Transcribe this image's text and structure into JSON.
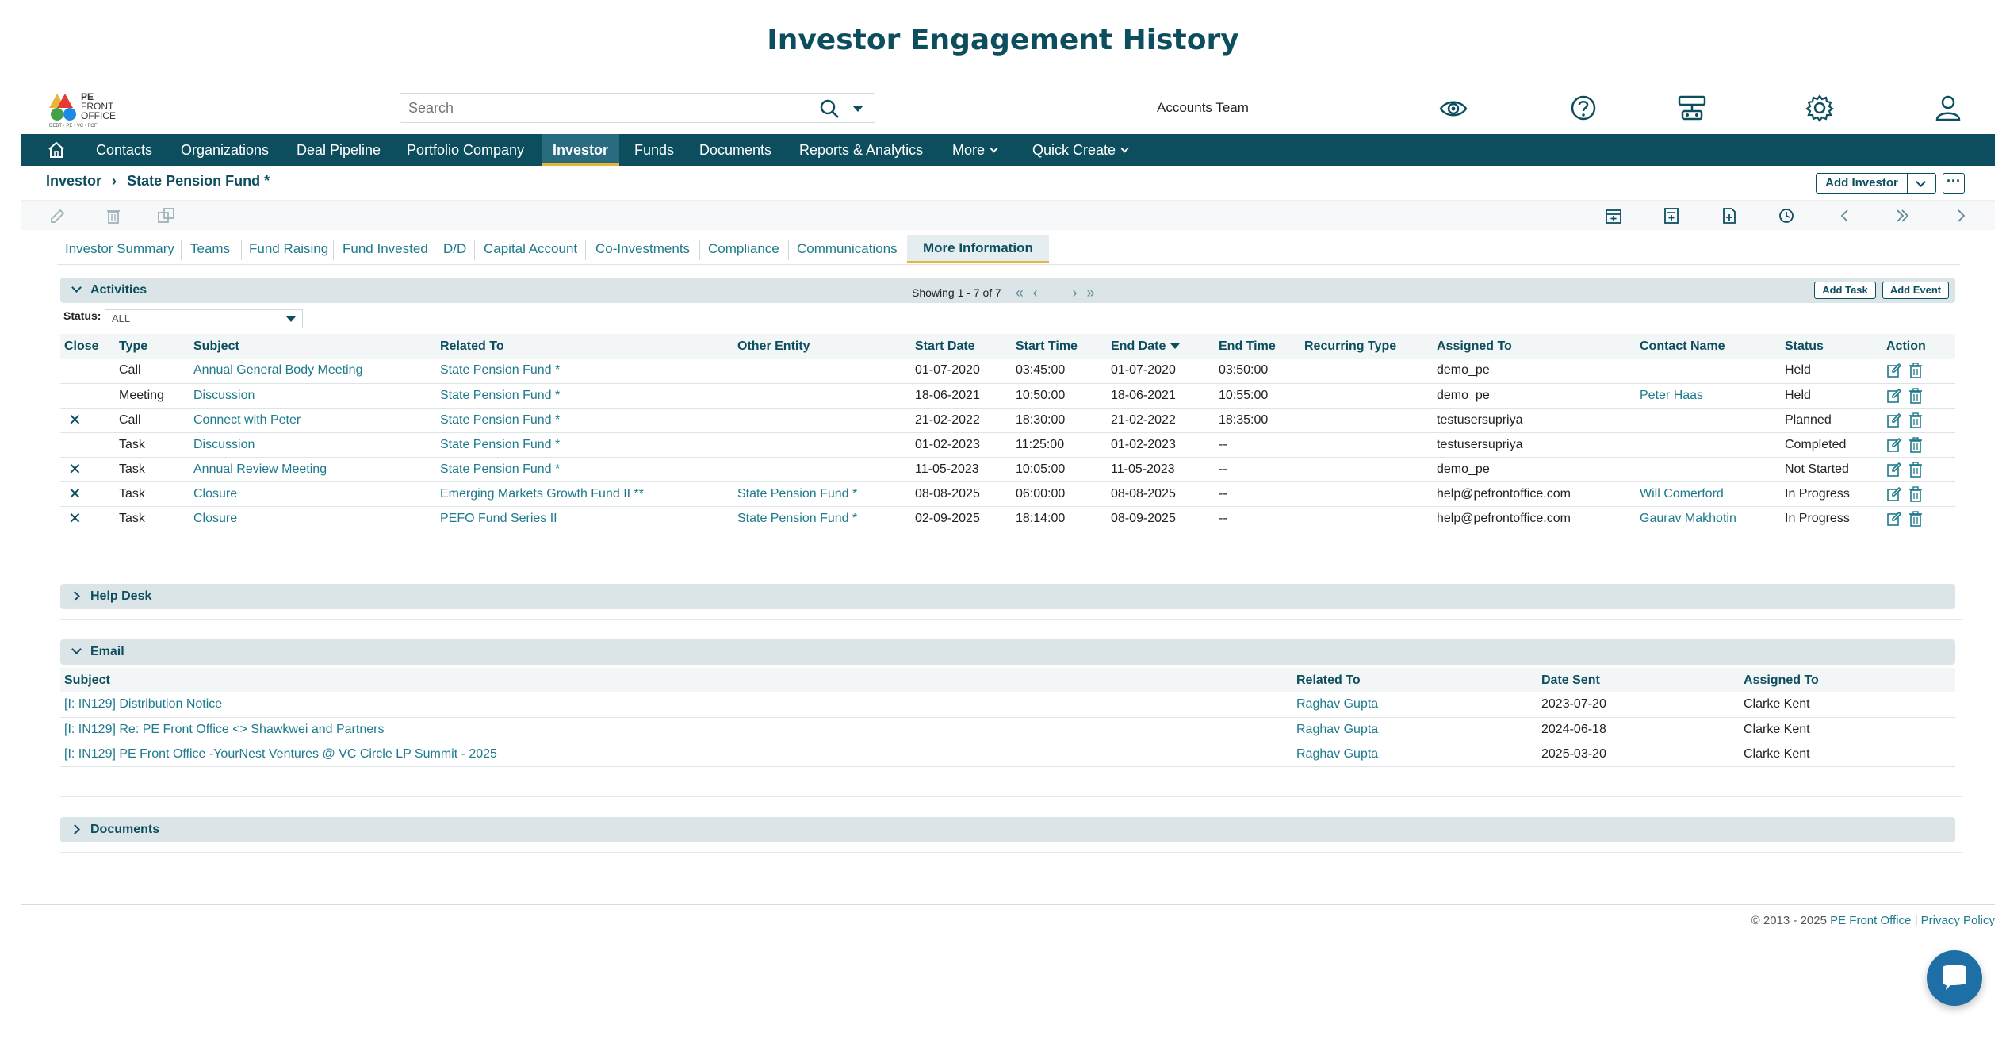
{
  "page_title": "Investor Engagement History",
  "header": {
    "logo_text_1": "PE",
    "logo_text_2": "FRONT",
    "logo_text_3": "OFFICE",
    "logo_sub": "DEBT • PE • VC • FOF",
    "search_placeholder": "Search",
    "team": "Accounts Team"
  },
  "nav": {
    "items": [
      "Contacts",
      "Organizations",
      "Deal Pipeline",
      "Portfolio Company",
      "Investor",
      "Funds",
      "Documents",
      "Reports & Analytics",
      "More",
      "Quick Create"
    ],
    "active": "Investor"
  },
  "breadcrumb": {
    "root": "Investor",
    "current": "State Pension Fund *"
  },
  "actions": {
    "add_investor": "Add Investor",
    "more": "···"
  },
  "tabs": [
    "Investor Summary",
    "Teams",
    "Fund Raising",
    "Fund Invested",
    "D/D",
    "Capital Account",
    "Co-Investments",
    "Compliance",
    "Communications",
    "More Information"
  ],
  "activities": {
    "title": "Activities",
    "pager": "Showing 1 - 7 of 7",
    "add_task": "Add Task",
    "add_event": "Add Event",
    "status_label": "Status:",
    "status_value": "ALL",
    "columns": [
      "Close",
      "Type",
      "Subject",
      "Related To",
      "Other Entity",
      "Start Date",
      "Start Time",
      "End Date",
      "End Time",
      "Recurring Type",
      "Assigned To",
      "Contact Name",
      "Status",
      "Action"
    ],
    "rows": [
      {
        "close": "",
        "type": "Call",
        "subject": "Annual General Body Meeting",
        "related": "State Pension Fund *",
        "other": "",
        "start_date": "01-07-2020",
        "start_time": "03:45:00",
        "end_date": "01-07-2020",
        "end_time": "03:50:00",
        "recurring": "",
        "assigned": "demo_pe",
        "contact": "",
        "status": "Held"
      },
      {
        "close": "",
        "type": "Meeting",
        "subject": "Discussion",
        "related": "State Pension Fund *",
        "other": "",
        "start_date": "18-06-2021",
        "start_time": "10:50:00",
        "end_date": "18-06-2021",
        "end_time": "10:55:00",
        "recurring": "",
        "assigned": "demo_pe",
        "contact": "Peter Haas",
        "status": "Held"
      },
      {
        "close": "✕",
        "type": "Call",
        "subject": "Connect with Peter",
        "related": "State Pension Fund *",
        "other": "",
        "start_date": "21-02-2022",
        "start_time": "18:30:00",
        "end_date": "21-02-2022",
        "end_time": "18:35:00",
        "recurring": "",
        "assigned": "testusersupriya",
        "contact": "",
        "status": "Planned"
      },
      {
        "close": "",
        "type": "Task",
        "subject": "Discussion",
        "related": "State Pension Fund *",
        "other": "",
        "start_date": "01-02-2023",
        "start_time": "11:25:00",
        "end_date": "01-02-2023",
        "end_time": "--",
        "recurring": "",
        "assigned": "testusersupriya",
        "contact": "",
        "status": "Completed"
      },
      {
        "close": "✕",
        "type": "Task",
        "subject": "Annual Review Meeting",
        "related": "State Pension Fund *",
        "other": "",
        "start_date": "11-05-2023",
        "start_time": "10:05:00",
        "end_date": "11-05-2023",
        "end_time": "--",
        "recurring": "",
        "assigned": "demo_pe",
        "contact": "",
        "status": "Not Started"
      },
      {
        "close": "✕",
        "type": "Task",
        "subject": "Closure",
        "related": "Emerging Markets Growth Fund II **",
        "other": "State Pension Fund *",
        "start_date": "08-08-2025",
        "start_time": "06:00:00",
        "end_date": "08-08-2025",
        "end_time": "--",
        "recurring": "",
        "assigned": "help@pefrontoffice.com",
        "contact": "Will Comerford",
        "status": "In Progress"
      },
      {
        "close": "✕",
        "type": "Task",
        "subject": "Closure",
        "related": "PEFO Fund Series II",
        "other": "State Pension Fund *",
        "start_date": "02-09-2025",
        "start_time": "18:14:00",
        "end_date": "08-09-2025",
        "end_time": "--",
        "recurring": "",
        "assigned": "help@pefrontoffice.com",
        "contact": "Gaurav Makhotin",
        "status": "In Progress"
      }
    ]
  },
  "helpdesk": {
    "title": "Help Desk"
  },
  "email": {
    "title": "Email",
    "columns": [
      "Subject",
      "Related To",
      "Date Sent",
      "Assigned To"
    ],
    "rows": [
      {
        "subject": "[I: IN129] Distribution Notice",
        "related": "Raghav Gupta",
        "date": "2023-07-20",
        "assigned": "Clarke Kent"
      },
      {
        "subject": "[I: IN129] Re: PE Front Office <> Shawkwei and Partners",
        "related": "Raghav Gupta",
        "date": "2024-06-18",
        "assigned": "Clarke Kent"
      },
      {
        "subject": "[I: IN129] PE Front Office -YourNest Ventures @ VC Circle LP Summit - 2025",
        "related": "Raghav Gupta",
        "date": "2025-03-20",
        "assigned": "Clarke Kent"
      }
    ]
  },
  "documents": {
    "title": "Documents"
  },
  "footer": {
    "copyright": "© 2013 - 2025",
    "brand": "PE Front Office",
    "sep": "|",
    "privacy": "Privacy Policy"
  }
}
